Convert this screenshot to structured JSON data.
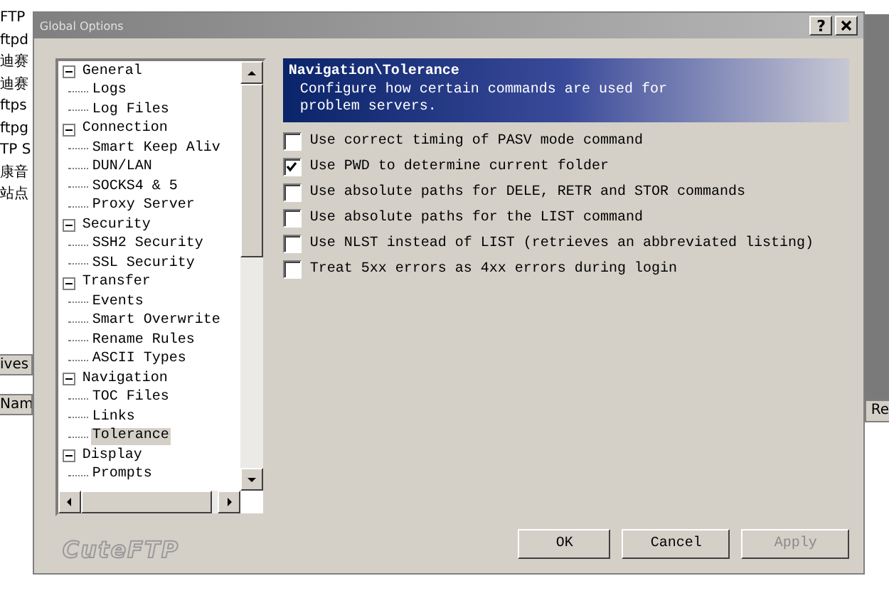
{
  "background_app": {
    "list_items": [
      "FTP",
      "ftpd",
      "迪赛",
      "迪赛",
      "ftps",
      "ftpg",
      "TP S",
      "康音",
      "站点"
    ],
    "left_buttons": [
      "ives",
      "Nam"
    ],
    "right_button": "Re"
  },
  "window": {
    "title": "Global Options",
    "help_button": "?"
  },
  "tree": [
    {
      "label": "General",
      "expanded": true,
      "selected": false,
      "children": [
        {
          "label": "Logs",
          "selected": false
        },
        {
          "label": "Log Files",
          "selected": false
        }
      ]
    },
    {
      "label": "Connection",
      "expanded": true,
      "selected": false,
      "children": [
        {
          "label": "Smart Keep Aliv",
          "selected": false
        },
        {
          "label": "DUN/LAN",
          "selected": false
        },
        {
          "label": "SOCKS4 & 5",
          "selected": false
        },
        {
          "label": "Proxy Server",
          "selected": false
        }
      ]
    },
    {
      "label": "Security",
      "expanded": true,
      "selected": false,
      "children": [
        {
          "label": "SSH2 Security",
          "selected": false
        },
        {
          "label": "SSL Security",
          "selected": false
        }
      ]
    },
    {
      "label": "Transfer",
      "expanded": true,
      "selected": false,
      "children": [
        {
          "label": "Events",
          "selected": false
        },
        {
          "label": "Smart Overwrite",
          "selected": false
        },
        {
          "label": "Rename Rules",
          "selected": false
        },
        {
          "label": "ASCII Types",
          "selected": false
        }
      ]
    },
    {
      "label": "Navigation",
      "expanded": true,
      "selected": false,
      "children": [
        {
          "label": "TOC Files",
          "selected": false
        },
        {
          "label": "Links",
          "selected": false
        },
        {
          "label": "Tolerance",
          "selected": true
        }
      ]
    },
    {
      "label": "Display",
      "expanded": true,
      "selected": false,
      "children": [
        {
          "label": "Prompts",
          "selected": false
        }
      ]
    }
  ],
  "header": {
    "title": "Navigation\\Tolerance",
    "description": "Configure how certain commands are used for problem servers."
  },
  "options": [
    {
      "label": "Use correct timing of PASV mode command",
      "checked": false
    },
    {
      "label": "Use PWD to determine current folder",
      "checked": true
    },
    {
      "label": "Use absolute paths for DELE, RETR and STOR commands",
      "checked": false
    },
    {
      "label": "Use absolute paths for the LIST command",
      "checked": false
    },
    {
      "label": "Use NLST instead of LIST (retrieves an abbreviated listing)",
      "checked": false
    },
    {
      "label": "Treat 5xx errors as 4xx errors during login",
      "checked": false
    }
  ],
  "logo": "CuteFTP",
  "buttons": [
    {
      "label": "OK",
      "disabled": false
    },
    {
      "label": "Cancel",
      "disabled": false
    },
    {
      "label": "Apply",
      "disabled": true
    }
  ]
}
